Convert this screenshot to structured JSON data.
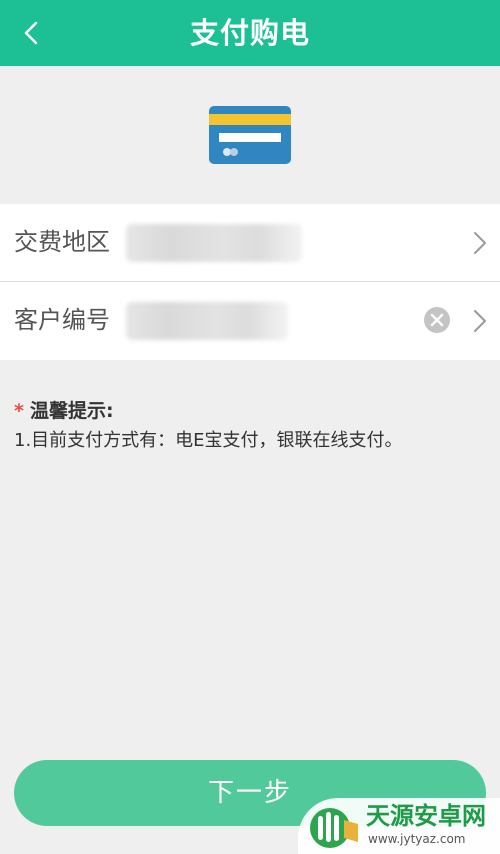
{
  "header": {
    "title": "支付购电"
  },
  "icons": {
    "back": "chevron-left-icon",
    "card": "credit-card-icon",
    "chevron": "chevron-right-icon",
    "clear": "clear-circle-icon"
  },
  "form": {
    "area_label": "交费地区",
    "customer_label": "客户编号"
  },
  "tips": {
    "star": "*",
    "title": "温馨提示:",
    "line1": "1.目前支付方式有：电E宝支付，银联在线支付。"
  },
  "next_button": {
    "label": "下一步"
  },
  "watermark": {
    "name": "天源安卓网",
    "url": "www.jytyaz.com"
  },
  "colors": {
    "header": "#1dbf95",
    "button": "#52c99b",
    "star": "#e54d42",
    "watermark_text": "#1f9a47"
  }
}
